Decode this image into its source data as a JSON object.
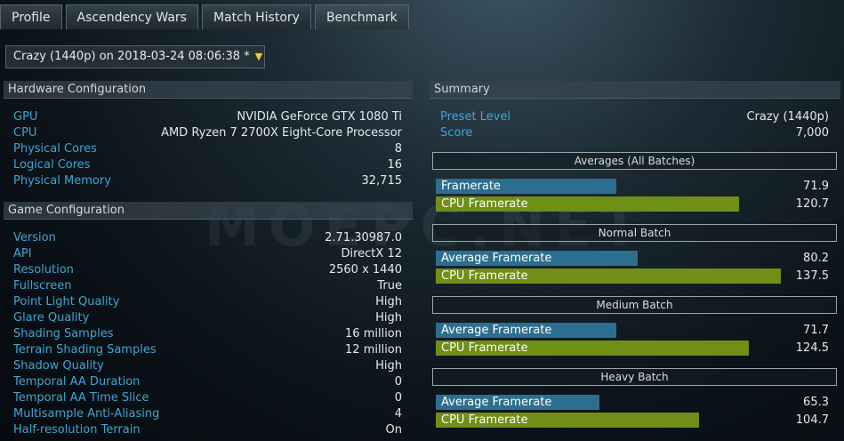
{
  "tabs": [
    "Profile",
    "Ascendency Wars",
    "Match History",
    "Benchmark"
  ],
  "run_select": {
    "label": "Crazy (1440p) on 2018-03-24 08:06:38 *",
    "arrow": "▼"
  },
  "watermark": "MOEPC.NET",
  "hardware": {
    "title": "Hardware Configuration",
    "rows": [
      {
        "k": "GPU",
        "v": "NVIDIA GeForce GTX 1080 Ti"
      },
      {
        "k": "CPU",
        "v": "AMD Ryzen 7 2700X Eight-Core Processor"
      },
      {
        "k": "Physical Cores",
        "v": "8"
      },
      {
        "k": "Logical Cores",
        "v": "16"
      },
      {
        "k": "Physical Memory",
        "v": "32,715"
      }
    ]
  },
  "game": {
    "title": "Game Configuration",
    "rows": [
      {
        "k": "Version",
        "v": "2.71.30987.0"
      },
      {
        "k": "API",
        "v": "DirectX 12"
      },
      {
        "k": "Resolution",
        "v": "2560 x 1440"
      },
      {
        "k": "Fullscreen",
        "v": "True"
      },
      {
        "k": "Point Light Quality",
        "v": "High"
      },
      {
        "k": "Glare Quality",
        "v": "High"
      },
      {
        "k": "Shading Samples",
        "v": "16 million"
      },
      {
        "k": "Terrain Shading Samples",
        "v": "12 million"
      },
      {
        "k": "Shadow Quality",
        "v": "High"
      },
      {
        "k": "Temporal AA Duration",
        "v": "0"
      },
      {
        "k": "Temporal AA Time Slice",
        "v": "0"
      },
      {
        "k": "Multisample Anti-Aliasing",
        "v": "4"
      },
      {
        "k": "Half-resolution Terrain",
        "v": "On"
      }
    ]
  },
  "summary": {
    "title": "Summary",
    "rows": [
      {
        "k": "Preset Level",
        "v": "Crazy (1440p)"
      },
      {
        "k": "Score",
        "v": "7,000"
      }
    ],
    "scale_max": 160,
    "batches": [
      {
        "title": "Averages (All Batches)",
        "bars": [
          {
            "label": "Framerate",
            "value": 71.9,
            "display": "71.9",
            "color": "#2c6e8f"
          },
          {
            "label": "CPU Framerate",
            "value": 120.7,
            "display": "120.7",
            "color": "#6f8f16"
          }
        ]
      },
      {
        "title": "Normal Batch",
        "bars": [
          {
            "label": "Average Framerate",
            "value": 80.2,
            "display": "80.2",
            "color": "#2c6e8f"
          },
          {
            "label": "CPU Framerate",
            "value": 137.5,
            "display": "137.5",
            "color": "#6f8f16"
          }
        ]
      },
      {
        "title": "Medium Batch",
        "bars": [
          {
            "label": "Average Framerate",
            "value": 71.7,
            "display": "71.7",
            "color": "#2c6e8f"
          },
          {
            "label": "CPU Framerate",
            "value": 124.5,
            "display": "124.5",
            "color": "#6f8f16"
          }
        ]
      },
      {
        "title": "Heavy Batch",
        "bars": [
          {
            "label": "Average Framerate",
            "value": 65.3,
            "display": "65.3",
            "color": "#2c6e8f"
          },
          {
            "label": "CPU Framerate",
            "value": 104.7,
            "display": "104.7",
            "color": "#6f8f16"
          }
        ]
      }
    ]
  }
}
